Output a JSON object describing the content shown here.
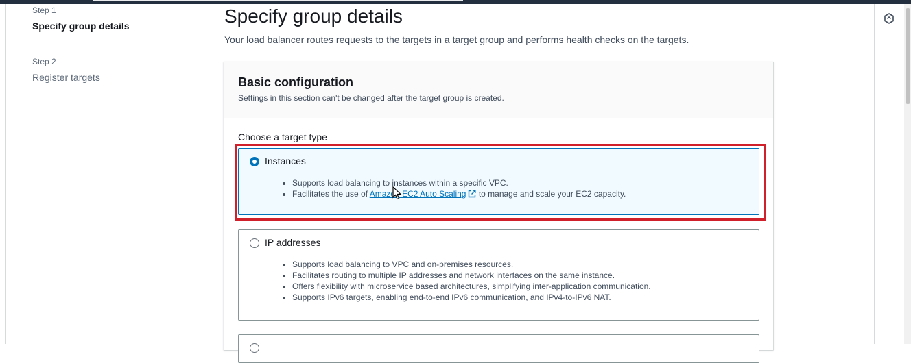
{
  "nav": {
    "steps": [
      {
        "caption": "Step 1",
        "title": "Specify group details"
      },
      {
        "caption": "Step 2",
        "title": "Register targets"
      }
    ]
  },
  "main": {
    "title": "Specify group details",
    "description": "Your load balancer routes requests to the targets in a target group and performs health checks on the targets."
  },
  "panel": {
    "title": "Basic configuration",
    "subtitle": "Settings in this section can't be changed after the target group is created.",
    "field_label": "Choose a target type",
    "options": {
      "instances": {
        "title": "Instances",
        "selected": true,
        "bullet1": "Supports load balancing to instances within a specific VPC.",
        "bullet2_pre": "Facilitates the use of ",
        "bullet2_link": "Amazon EC2 Auto Scaling",
        "bullet2_post": " to manage and scale your EC2 capacity."
      },
      "ip": {
        "title": "IP addresses",
        "selected": false,
        "bullets": [
          "Supports load balancing to VPC and on-premises resources.",
          "Facilitates routing to multiple IP addresses and network interfaces on the same instance.",
          "Offers flexibility with microservice based architectures, simplifying inter-application communication.",
          "Supports IPv6 targets, enabling end-to-end IPv6 communication, and IPv4-to-IPv6 NAT."
        ]
      }
    }
  },
  "icons": {
    "external_link": "external-link-icon",
    "side_panel": "info-panel-icon"
  },
  "colors": {
    "accent": "#0073bb",
    "highlight_box": "#d0202c",
    "selected_tile_bg": "#f1faff",
    "top_bar": "#232f3e"
  }
}
